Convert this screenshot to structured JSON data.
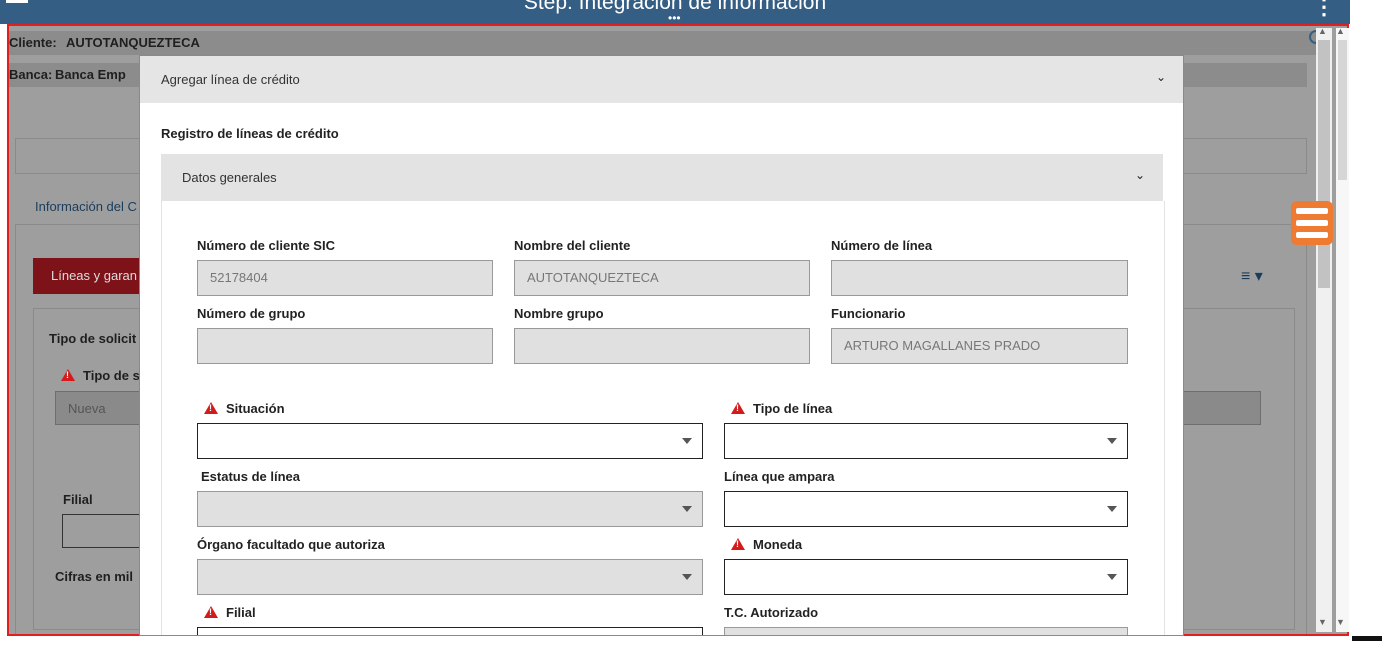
{
  "topbar": {
    "title": "Step: Integración de información",
    "dots": "•••",
    "kebab": "⋮"
  },
  "background": {
    "cliente_label": "Cliente:",
    "cliente_value": "AUTOTANQUEZTECA",
    "banca_label": "Banca:",
    "banca_value": "Banca Emp",
    "info_tab": "Información del C",
    "lineas_button": "Líneas y garan",
    "tipo_solicitud": "Tipo de solicit",
    "tipo_s": "Tipo de s",
    "nueva_value": "Nueva",
    "filial_label": "Filial",
    "cifras_label": "Cifras en mil"
  },
  "modal": {
    "header_title": "Agregar línea de crédito",
    "registro_title": "Registro de líneas de crédito",
    "section_title": "Datos generales",
    "fields": {
      "numero_cliente_label": "Número de cliente SIC",
      "numero_cliente_value": "52178404",
      "nombre_cliente_label": "Nombre del cliente",
      "nombre_cliente_value": "AUTOTANQUEZTECA",
      "numero_linea_label": "Número de línea",
      "numero_linea_value": "",
      "numero_grupo_label": "Número de grupo",
      "numero_grupo_value": "",
      "nombre_grupo_label": "Nombre grupo",
      "nombre_grupo_value": "",
      "funcionario_label": "Funcionario",
      "funcionario_value": "ARTURO MAGALLANES PRADO",
      "situacion_label": "Situación",
      "tipo_linea_label": "Tipo de línea",
      "estatus_linea_label": "Estatus de línea",
      "linea_ampara_label": "Línea que ampara",
      "organo_label": "Órgano facultado que autoriza",
      "moneda_label": "Moneda",
      "filial_label": "Filial",
      "tc_autorizado_label": "T.C. Autorizado"
    }
  },
  "colors": {
    "topbar": "#345e83",
    "accent_red": "#d41b1b",
    "orange_menu": "#ef7a31"
  }
}
